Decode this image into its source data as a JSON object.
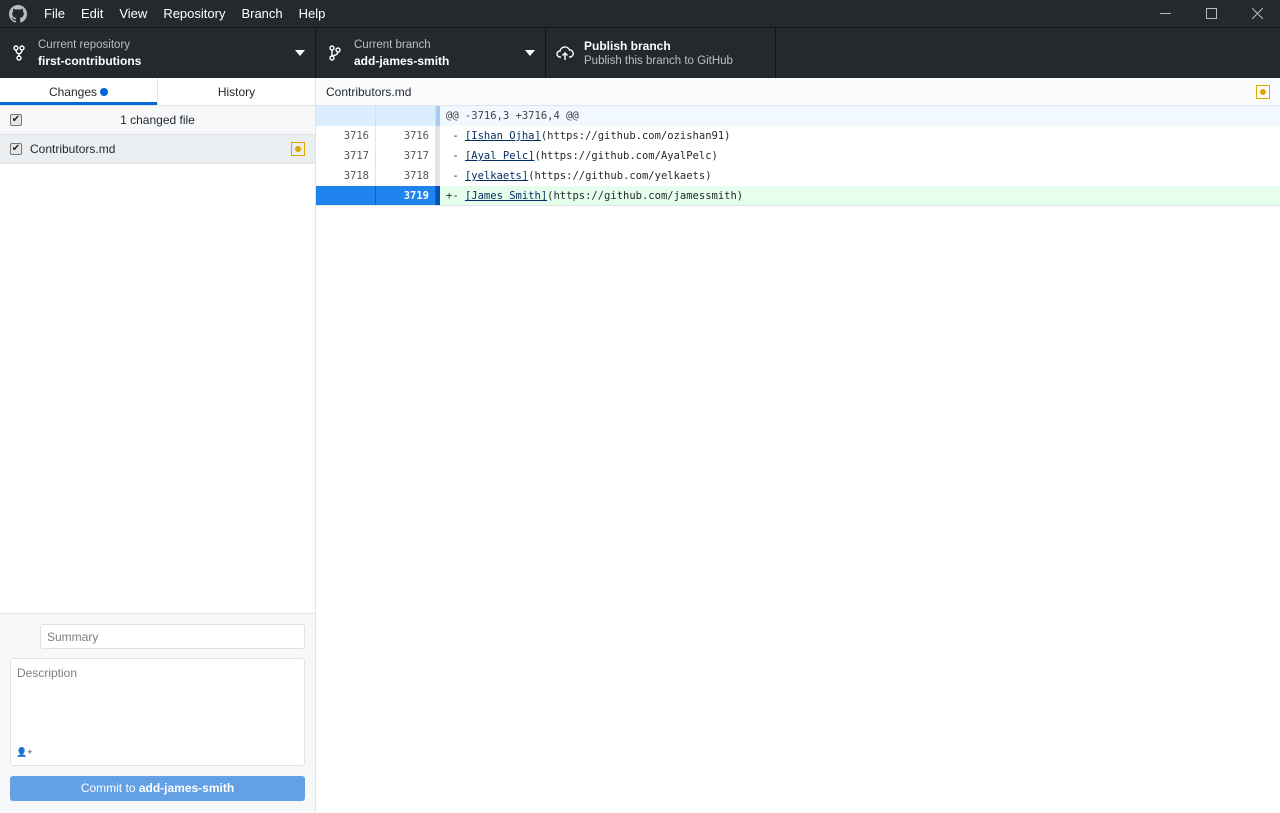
{
  "titlebar": {
    "menu": [
      "File",
      "Edit",
      "View",
      "Repository",
      "Branch",
      "Help"
    ]
  },
  "toolbar": {
    "repository": {
      "label": "Current repository",
      "value": "first-contributions"
    },
    "branch": {
      "label": "Current branch",
      "value": "add-james-smith"
    },
    "publish": {
      "title": "Publish branch",
      "subtitle": "Publish this branch to GitHub"
    }
  },
  "sidebar": {
    "tabs": [
      {
        "label": "Changes"
      },
      {
        "label": "History"
      }
    ],
    "changes_summary": "1 changed file",
    "files": [
      {
        "name": "Contributors.md",
        "status": "modified"
      }
    ],
    "commit": {
      "summary_placeholder": "Summary",
      "description_placeholder": "Description",
      "button_prefix": "Commit to ",
      "button_branch": "add-james-smith"
    }
  },
  "diff": {
    "file": "Contributors.md",
    "hunk_header": "@@ -3716,3 +3716,4 @@",
    "lines": [
      {
        "old": "3716",
        "new": "3716",
        "prefix": " - ",
        "link": "[Ishan Ojha]",
        "rest": "(https://github.com/ozishan91)"
      },
      {
        "old": "3717",
        "new": "3717",
        "prefix": " - ",
        "link": "[Ayal Pelc]",
        "rest": "(https://github.com/AyalPelc)"
      },
      {
        "old": "3718",
        "new": "3718",
        "prefix": " - ",
        "link": "[yelkaets]",
        "rest": "(https://github.com/yelkaets)"
      },
      {
        "old": "",
        "new": "3719",
        "prefix": "+- ",
        "link": "[James Smith]",
        "rest": "(https://github.com/jamessmith)"
      }
    ]
  },
  "colors": {
    "accent": "#0366d6",
    "modified": "#dba800",
    "added_bg": "#e6ffed"
  }
}
